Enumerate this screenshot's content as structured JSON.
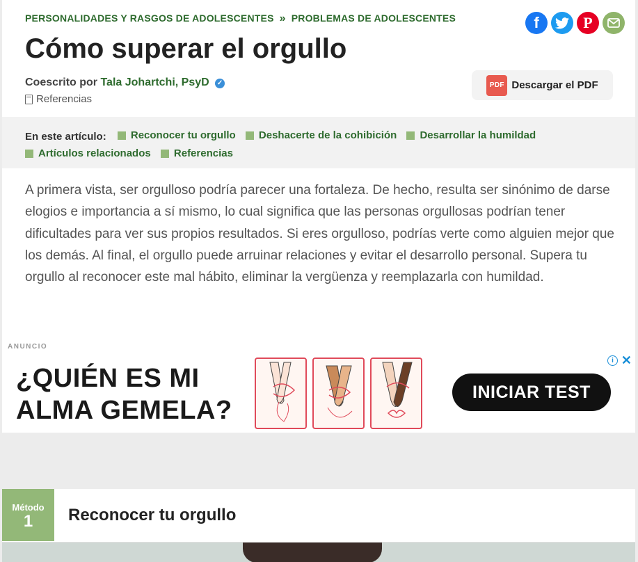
{
  "breadcrumb": {
    "item1": "PERSONALIDADES Y RASGOS DE ADOLESCENTES",
    "separator": "»",
    "item2": "PROBLEMAS DE ADOLESCENTES"
  },
  "share": {
    "facebook_icon": "f",
    "pinterest_icon": "P"
  },
  "article": {
    "title": "Cómo superar el orgullo",
    "coauthor_prefix": "Coescrito por",
    "author": "Tala Johartchi, PsyD",
    "verified_icon": "✓",
    "references_label": "Referencias",
    "pdf_icon_text": "PDF",
    "pdf_button": "Descargar el PDF"
  },
  "toc": {
    "label": "En este artículo:",
    "items": [
      "Reconocer tu orgullo",
      "Deshacerte de la cohibición",
      "Desarrollar la humildad",
      "Artículos relacionados",
      "Referencias"
    ]
  },
  "intro": "A primera vista, ser orgulloso podría parecer una fortaleza. De hecho, resulta ser sinónimo de darse elogios e importancia a sí mismo, lo cual significa que las personas orgullosas podrían tener dificultades para ver sus propios resultados. Si eres orgulloso, podrías verte como alguien mejor que los demás. Al final, el orgullo puede arruinar relaciones y evitar el desarrollo personal. Supera tu orgullo al reconocer este mal hábito, eliminar la vergüenza y reemplazarla con humildad.",
  "ad": {
    "label": "ANUNCIO",
    "headline_line1": "¿QUIÉN ES MI",
    "headline_line2": "ALMA GEMELA?",
    "cta": "INICIAR TEST",
    "info_icon": "i",
    "close_icon": "✕"
  },
  "method": {
    "label": "Método",
    "number": "1",
    "title": "Reconocer tu orgullo"
  },
  "colors": {
    "accent_green": "#2e6b2e",
    "badge_green": "#93b878",
    "facebook": "#1877f2",
    "twitter": "#1d9bf0",
    "pinterest": "#e60023",
    "email": "#8fb46a"
  }
}
